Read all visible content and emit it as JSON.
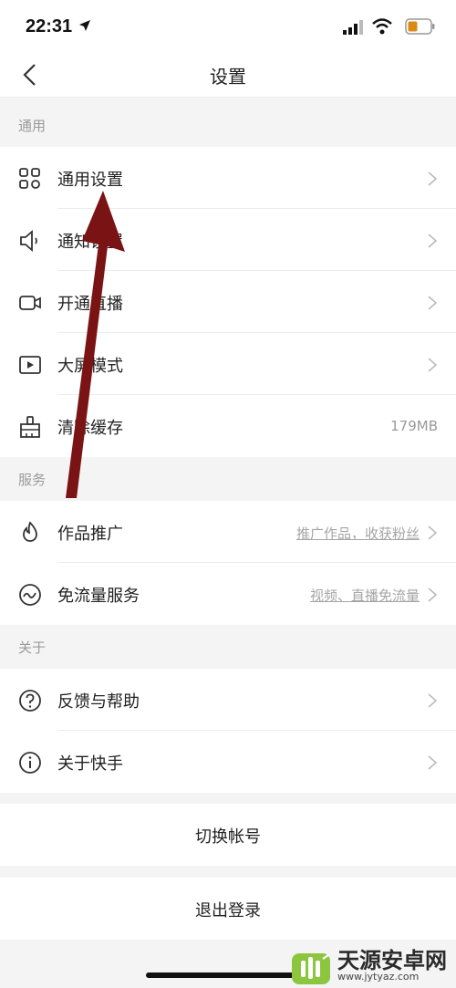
{
  "status_bar": {
    "time": "22:31",
    "icons": [
      "location-arrow-icon",
      "signal-icon",
      "wifi-icon",
      "battery-icon"
    ]
  },
  "nav": {
    "title": "设置",
    "back_icon": "chevron-left-icon"
  },
  "sections": {
    "general": {
      "header": "通用",
      "items": [
        {
          "label": "通用设置",
          "icon": "grid-icon"
        },
        {
          "label": "通知设置",
          "icon": "speaker-icon"
        },
        {
          "label": "开通直播",
          "icon": "camera-icon"
        },
        {
          "label": "大屏模式",
          "icon": "play-icon"
        },
        {
          "label": "清除缓存",
          "icon": "brush-icon",
          "value": "179MB"
        }
      ]
    },
    "service": {
      "header": "服务",
      "items": [
        {
          "label": "作品推广",
          "icon": "flame-icon",
          "link": "推广作品，收获粉丝"
        },
        {
          "label": "免流量服务",
          "icon": "data-wave-icon",
          "link": "视频、直播免流量"
        }
      ]
    },
    "about": {
      "header": "关于",
      "items": [
        {
          "label": "反馈与帮助",
          "icon": "question-icon"
        },
        {
          "label": "关于快手",
          "icon": "info-icon"
        }
      ]
    }
  },
  "actions": {
    "switch_account": "切换帐号",
    "logout": "退出登录"
  },
  "watermark": {
    "title": "天源安卓网",
    "url": "www.jytyaz.com"
  },
  "colors": {
    "background": "#f4f4f4",
    "row": "#ffffff",
    "text": "#222222",
    "muted": "#9a9a9a",
    "annotation_arrow": "#7a1313"
  }
}
